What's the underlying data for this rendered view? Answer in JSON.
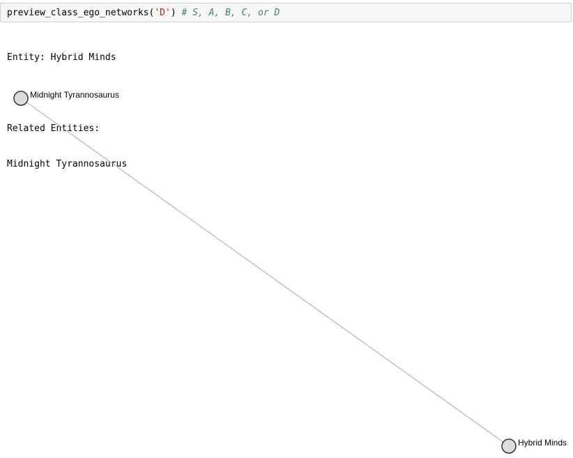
{
  "code_cell": {
    "call": "preview_class_ego_networks(",
    "arg": "'D'",
    "close": ")",
    "comment": "# S, A, B, C, or D"
  },
  "output": {
    "entity_line": "Entity: Hybrid Minds",
    "related_header": "Related Entities:",
    "related": [
      "Midnight Tyrannosaurus"
    ]
  },
  "network": {
    "nodes": [
      {
        "id": "midnight",
        "label": "Midnight Tyrannosaurus"
      },
      {
        "id": "hybrid",
        "label": "Hybrid Minds"
      }
    ],
    "edges": [
      {
        "source": "midnight",
        "target": "hybrid"
      }
    ],
    "colors": {
      "node_fill": "#dddddd",
      "node_stroke": "#333333",
      "edge": "#a9a9a9"
    }
  }
}
